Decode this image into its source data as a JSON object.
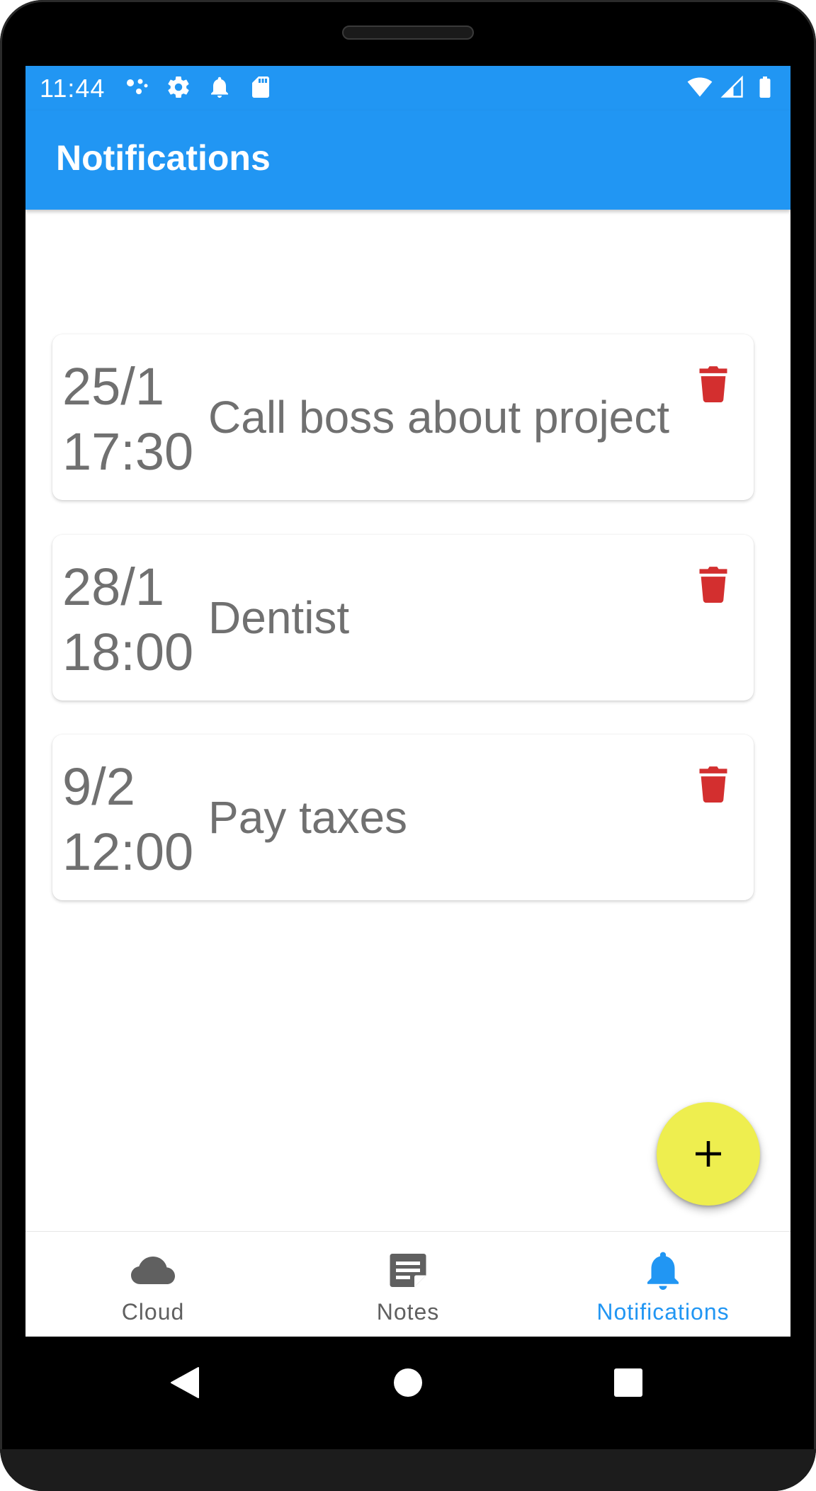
{
  "status_bar": {
    "time": "11:44",
    "icons_left": [
      "assistant-dots-icon",
      "gear-icon",
      "bell-icon",
      "sd-card-icon"
    ],
    "icons_right": [
      "wifi-icon",
      "cell-signal-icon",
      "battery-icon"
    ]
  },
  "app_bar": {
    "title": "Notifications",
    "color": "#2196f3"
  },
  "notifications": [
    {
      "date": "25/1",
      "time": "17:30",
      "text": "Call boss about project"
    },
    {
      "date": "28/1",
      "time": "18:00",
      "text": "Dentist"
    },
    {
      "date": "9/2",
      "time": "12:00",
      "text": "Pay taxes"
    }
  ],
  "delete_icon": "trash-icon",
  "delete_color": "#d32f2f",
  "fab": {
    "icon": "plus-icon",
    "color": "#eeee4f"
  },
  "bottom_nav": {
    "items": [
      {
        "label": "Cloud",
        "icon": "cloud-icon",
        "active": false
      },
      {
        "label": "Notes",
        "icon": "note-icon",
        "active": false
      },
      {
        "label": "Notifications",
        "icon": "bell-icon",
        "active": true
      }
    ],
    "active_color": "#2196f3",
    "inactive_color": "#606060"
  },
  "system_nav": [
    "back-icon",
    "home-icon",
    "recents-icon"
  ]
}
